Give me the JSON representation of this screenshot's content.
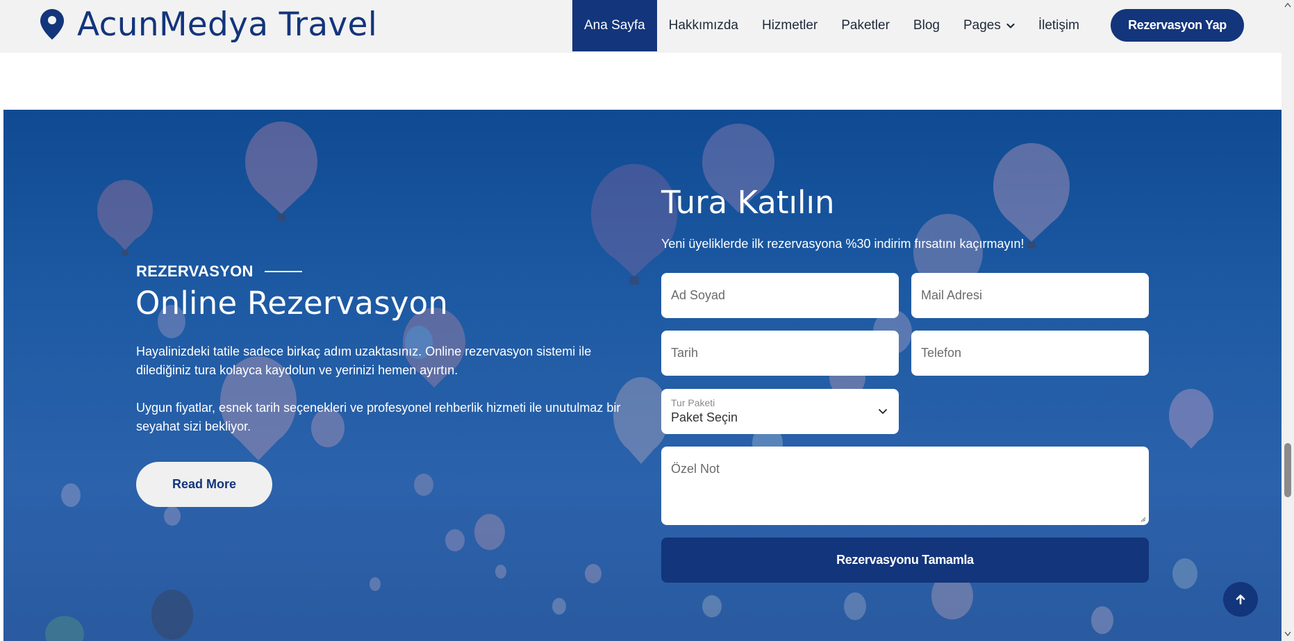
{
  "brand": {
    "name": "AcunMedya Travel",
    "icon": "map-pin-icon"
  },
  "nav": {
    "items": [
      {
        "label": "Ana Sayfa",
        "active": true
      },
      {
        "label": "Hakkımızda"
      },
      {
        "label": "Hizmetler"
      },
      {
        "label": "Paketler"
      },
      {
        "label": "Blog"
      },
      {
        "label": "Pages",
        "has_dropdown": true
      },
      {
        "label": "İletişim"
      }
    ],
    "cta_label": "Rezervasyon Yap"
  },
  "hero": {
    "eyebrow": "REZERVASYON",
    "title": "Online Rezervasyon",
    "paragraph1": "Hayalinizdeki tatile sadece birkaç adım uzaktasınız. Online rezervasyon sistemi ile dilediğiniz tura kolayca kaydolun ve yerinizi hemen ayırtın.",
    "paragraph2": "Uygun fiyatlar, esnek tarih seçenekleri ve profesyonel rehberlik hizmeti ile unutulmaz bir seyahat sizi bekliyor.",
    "read_more_label": "Read More"
  },
  "form": {
    "title": "Tura Katılın",
    "subtitle": "Yeni üyeliklerde ilk rezervasyona %30 indirim fırsatını kaçırmayın!",
    "name_placeholder": "Ad Soyad",
    "email_placeholder": "Mail Adresi",
    "date_placeholder": "Tarih",
    "phone_placeholder": "Telefon",
    "package_label": "Tur Paketi",
    "package_value": "Paket Seçin",
    "note_placeholder": "Özel Not",
    "submit_label": "Rezervasyonu Tamamla"
  },
  "colors": {
    "brand_blue": "#13357b",
    "hero_blue": "#1d5aa3",
    "navbar_bg": "#f2f2f2"
  },
  "icons": {
    "back_to_top": "arrow-up-icon",
    "dropdown": "chevron-down-icon"
  }
}
